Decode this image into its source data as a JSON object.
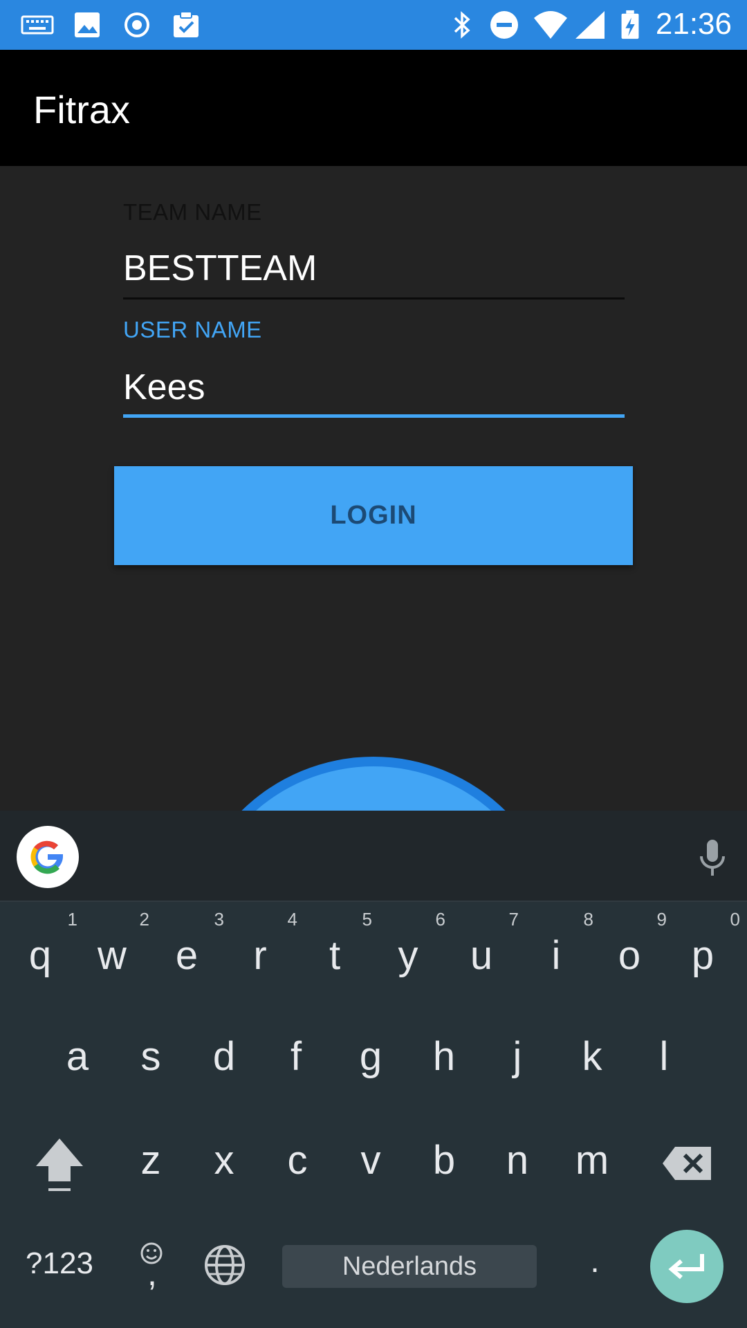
{
  "status_bar": {
    "time": "21:36",
    "icons": [
      "keyboard-icon",
      "image-icon",
      "record-icon",
      "clipboard-check-icon",
      "bluetooth-icon",
      "do-not-disturb-icon",
      "wifi-icon",
      "signal-icon",
      "battery-charging-icon"
    ]
  },
  "app_bar": {
    "title": "Fitrax"
  },
  "form": {
    "team": {
      "label": "TEAM NAME",
      "value": "BESTTEAM"
    },
    "user": {
      "label": "USER NAME",
      "value": "Kees"
    },
    "login_label": "LOGIN"
  },
  "colors": {
    "accent": "#42a5f5",
    "status_bar": "#2a87e0",
    "keyboard_bg": "#263238",
    "enter": "#7fcbc0"
  },
  "keyboard": {
    "row1": [
      {
        "k": "q",
        "h": "1"
      },
      {
        "k": "w",
        "h": "2"
      },
      {
        "k": "e",
        "h": "3"
      },
      {
        "k": "r",
        "h": "4"
      },
      {
        "k": "t",
        "h": "5"
      },
      {
        "k": "y",
        "h": "6"
      },
      {
        "k": "u",
        "h": "7"
      },
      {
        "k": "i",
        "h": "8"
      },
      {
        "k": "o",
        "h": "9"
      },
      {
        "k": "p",
        "h": "0"
      }
    ],
    "row2": [
      "a",
      "s",
      "d",
      "f",
      "g",
      "h",
      "j",
      "k",
      "l"
    ],
    "row3": [
      "z",
      "x",
      "c",
      "v",
      "b",
      "n",
      "m"
    ],
    "symbols_label": "?123",
    "emoji_comma": ",",
    "space_label": "Nederlands",
    "period": "."
  }
}
